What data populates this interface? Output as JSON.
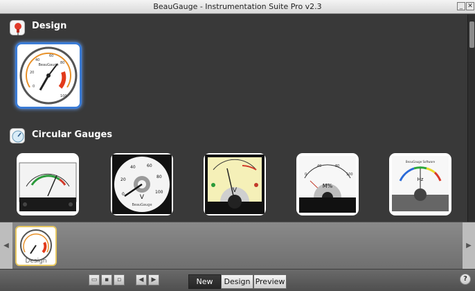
{
  "window": {
    "title": "BeauGauge - Instrumentation Suite Pro v2.3"
  },
  "sections": [
    {
      "title": "Design",
      "icon": "pushpin-icon"
    },
    {
      "title": "Circular Gauges",
      "icon": "gauge-icon"
    }
  ],
  "design_tile": {
    "brand": "BeauGauge",
    "ticks": [
      "0",
      "20",
      "40",
      "60",
      "80",
      "100"
    ]
  },
  "gauges": [
    {
      "name": "vu-meter"
    },
    {
      "name": "voltmeter",
      "unit": "V",
      "brand": "BeauGauge",
      "ticks": [
        "0",
        "20",
        "40",
        "60",
        "80",
        "100"
      ]
    },
    {
      "name": "amber-voltmeter",
      "unit": "V"
    },
    {
      "name": "m-percent-meter",
      "unit": "M%",
      "ticks": [
        "0",
        "40",
        "80",
        "100"
      ]
    },
    {
      "name": "hz-meter",
      "unit": "Hz",
      "brand": "BeauGauge Software"
    }
  ],
  "strip": {
    "thumb_label": "Design"
  },
  "toolbar": {
    "new_label": "New",
    "design_label": "Design",
    "preview_label": "Preview",
    "help_label": "?"
  },
  "colors": {
    "accent": "#3a7bd5",
    "selected_thumb_border": "#e8c860"
  }
}
